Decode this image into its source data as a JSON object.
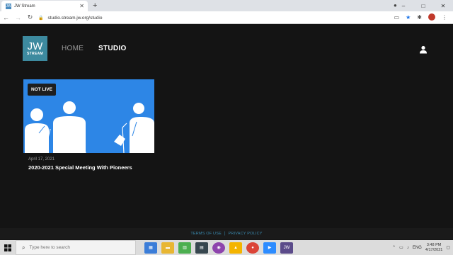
{
  "browser": {
    "tab_title": "JW Stream",
    "tab_favicon_text": "JW",
    "new_tab": "+",
    "url": "studio.stream.jw.org/studio",
    "window_controls": [
      "–",
      "□",
      "✕"
    ]
  },
  "header": {
    "logo_line1": "JW",
    "logo_line2": "STREAM",
    "nav": [
      {
        "label": "HOME"
      },
      {
        "label": "STUDIO"
      }
    ]
  },
  "card": {
    "badge": "NOT LIVE",
    "date": "April 17, 2021",
    "title": "2020-2021 Special Meeting With Pioneers"
  },
  "footer": {
    "terms": "TERMS OF USE",
    "separator": "|",
    "privacy": "PRIVACY POLICY"
  },
  "taskbar": {
    "search_placeholder": "Type here to search",
    "language": "ENG",
    "time": "3:48 PM",
    "date": "4/17/2021"
  },
  "colors": {
    "brand_teal": "#3d8a9f",
    "thumbnail_blue": "#2d86e6",
    "footer_link": "#3a8aaf"
  }
}
